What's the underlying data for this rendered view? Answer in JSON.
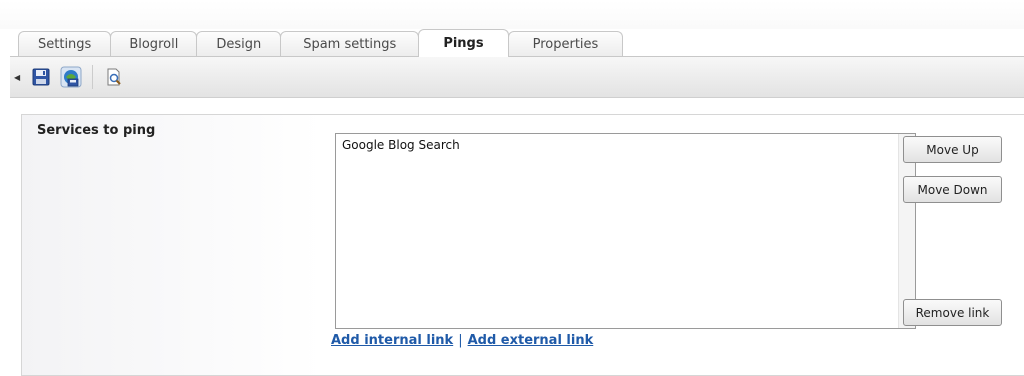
{
  "tabs": [
    {
      "label": "Settings",
      "active": false
    },
    {
      "label": "Blogroll",
      "active": false
    },
    {
      "label": "Design",
      "active": false
    },
    {
      "label": "Spam settings",
      "active": false
    },
    {
      "label": "Pings",
      "active": true
    },
    {
      "label": "Properties",
      "active": false
    }
  ],
  "toolbar": {
    "icons": [
      "collapse-arrow-icon",
      "save-icon",
      "spellcheck-icon",
      "preview-icon"
    ]
  },
  "form": {
    "field_label": "Services to ping",
    "services": [
      "Google Blog Search"
    ],
    "buttons": {
      "move_up": "Move Up",
      "move_down": "Move Down",
      "remove_link": "Remove link"
    },
    "links": {
      "add_internal": "Add internal link",
      "separator": "|",
      "add_external": "Add external link"
    }
  },
  "colors": {
    "link": "#1f5aa8",
    "tab_border": "#c8c8c8",
    "toolbar_bg": "#e9e9e9"
  }
}
